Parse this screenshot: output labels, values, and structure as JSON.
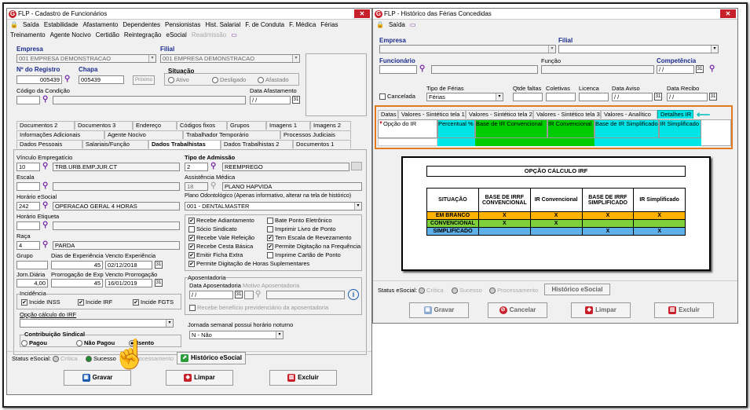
{
  "left": {
    "title": "FLP - Cadastro de Funcionários",
    "menu": [
      "Saída",
      "Estabilidade",
      "Afastamento",
      "Dependentes",
      "Pensionistas",
      "Hist. Salarial",
      "F. de Conduta",
      "F. Médica",
      "Férias"
    ],
    "menu2": [
      "Treinamento",
      "Agente Nocivo",
      "Certidão",
      "Reintegração",
      "eSocial",
      "Readmissão"
    ],
    "empresa_label": "Empresa",
    "empresa": "001 EMPRESA DEMONSTRACAO",
    "filial_label": "Filial",
    "filial": "001 EMPRESA DEMONSTRACAO",
    "registro_label": "Nº do Registro",
    "registro": "005439",
    "chapa_label": "Chapa",
    "chapa": "005439",
    "proximo": "Próximo",
    "situacao_label": "Situação",
    "sit_ativo": "Ativo",
    "sit_desligado": "Desligado",
    "sit_afastado": "Afastado",
    "codcond_label": "Código da Condição",
    "dataafast_label": "Data Afastamento",
    "dataafast": "/ /",
    "tabs_row1": [
      "Documentos 2",
      "Documentos 3",
      "Endereço",
      "Códigos fixos",
      "Grupos",
      "Imagens 1",
      "Imagens 2"
    ],
    "tabs_row2": [
      "Informações Adicionais",
      "Agente Nocivo",
      "Trabalhador Temporário",
      "Processos Judiciais"
    ],
    "tabs_row3": [
      "Dados Pessoais",
      "Salariais/Função",
      "Dados Trabalhistas",
      "Dados Trabalhistas 2",
      "Documentos 1"
    ],
    "vinculo_label": "Vínculo Empregatício",
    "vinculo_code": "10",
    "vinculo": "TRB.URB.EMP.JUR.CT",
    "escala_label": "Escala",
    "horario_label": "Horário eSocial",
    "horario_code": "242",
    "horario": "OPERACAO GERAL 4 HORAS",
    "etiqueta_label": "Horário Etiqueta",
    "raca_label": "Raça",
    "raca_code": "4",
    "raca": "PARDA",
    "grupo_label": "Grupo",
    "diasexp_label": "Dias de Experiência",
    "diasexp": "45",
    "vencexp_label": "Vencto Experiência",
    "vencexp": "02/12/2018",
    "jorn_label": "Jorn.Diária",
    "jorn": "4,00",
    "prorrog_label": "Prorrogação de Exp",
    "prorrog": "45",
    "vencprorrog_label": "Vencto Prorrogação",
    "vencprorrog": "16/01/2019",
    "incid_label": "Incidência",
    "inss": "Incide INSS",
    "irf": "Incide IRF",
    "fgts": "Incide FGTS",
    "opcao_ir_label": "Opção cálculo do IRF",
    "contrib_label": "Contribuição Sindical",
    "pagou": "Pagou",
    "naopagou": "Não Pagou",
    "isento": "Isento",
    "tipoadm_label": "Tipo de Admissão",
    "tipoadm_code": "2",
    "tipoadm": "REEMPREGO",
    "assist_label": "Assistência Médica",
    "assist_code": "18",
    "assist": "PLANO HAPVIDA",
    "plano_label": "Plano Odontológico (Apenas informativo, alterar na tela de histórico)",
    "plano": "001 - DENTALMASTER",
    "checks": [
      "Recebe Adiantamento",
      "Bate Ponto Eletrônico",
      "Sócio Sindicato",
      "Imprimir Livro de Ponto",
      "Recebe Vale Refeição",
      "Tem Escala de Revezamento",
      "Recebe Cesta Básica",
      "Permite Digitação na Frequência",
      "Emitir Ficha Extra",
      "Imprime Cartão de Ponto",
      "Permite Digitação de Horas Suplementares"
    ],
    "apos_label": "Aposentadoria",
    "dataapos_label": "Data Aposentadoria",
    "motivo_label": "Motivo Aposentadoria",
    "dataapos": "/ /",
    "recebe_benef": "Recebe benefício previdenciário da aposentadoria",
    "jornada_label": "Jornada semanal possui horário noturno",
    "jornada": "N - Não",
    "status_label": "Status eSocial:",
    "critica": "Crítica",
    "sucesso": "Sucesso",
    "processamento": "Processamento",
    "hist_esocial": "Histórico eSocial",
    "gravar": "Gravar",
    "limpar": "Limpar",
    "excluir": "Excluir"
  },
  "right": {
    "title": "FLP - Histórico das Férias Concedidas",
    "saida": "Saída",
    "empresa_label": "Empresa",
    "filial_label": "Filial",
    "func_label": "Funcionário",
    "funcao_label": "Função",
    "comp_label": "Competência",
    "comp": "/ /",
    "cancelada": "Cancelada",
    "tipoferias_label": "Tipo de Férias",
    "tipoferias": "Férias",
    "qtdefaltas_label": "Qtde faltas",
    "coletivas_label": "Coletivas",
    "licenca_label": "Licenca",
    "dataaviso_label": "Data Aviso",
    "dataaviso": "/ /",
    "datarecibo_label": "Data Recibo",
    "datarecibo": "/ /",
    "tabs": [
      "Datas",
      "Valores - Sintético tela 1",
      "Valores - Sintético tela 2",
      "Valores - Sintético tela 3",
      "Valores - Analítico",
      "Detalhes IR"
    ],
    "grid_headers": [
      "Opção do IR",
      "Percentual %",
      "Base de IR Convencional",
      "IR Convencional",
      "Base de IR Simplificado",
      "IR Simplificado"
    ],
    "table_title": "OPÇÃO CÁLCULO IRF",
    "table_headers": [
      "SITUAÇÃO",
      "BASE DE IRRF CONVENCIONAL",
      "IR Convencional",
      "BASE DE IRRF SIMPLIFICADO",
      "IR Simplificado"
    ],
    "table_rows": [
      [
        "EM BRANCO",
        "X",
        "X",
        "X",
        "X"
      ],
      [
        "CONVENCIONAL",
        "X",
        "X",
        "",
        ""
      ],
      [
        "SIMPLIFICADO",
        "",
        "",
        "X",
        "X"
      ]
    ],
    "status_label": "Status eSocial:",
    "critica": "Crítica",
    "sucesso": "Sucesso",
    "processamento": "Processamento",
    "hist_esocial": "Histórico eSocial",
    "gravar": "Gravar",
    "cancelar": "Cancelar",
    "limpar": "Limpar",
    "excluir": "Excluir"
  },
  "colors": {
    "accent": "#1a2c8c",
    "highlight_orange": "#e07b20",
    "cyan": "#00e5e5",
    "green": "#00cc00",
    "em_branco": "#ffb300",
    "convencional": "#7fd13b",
    "simplificado": "#5fb0e8"
  }
}
